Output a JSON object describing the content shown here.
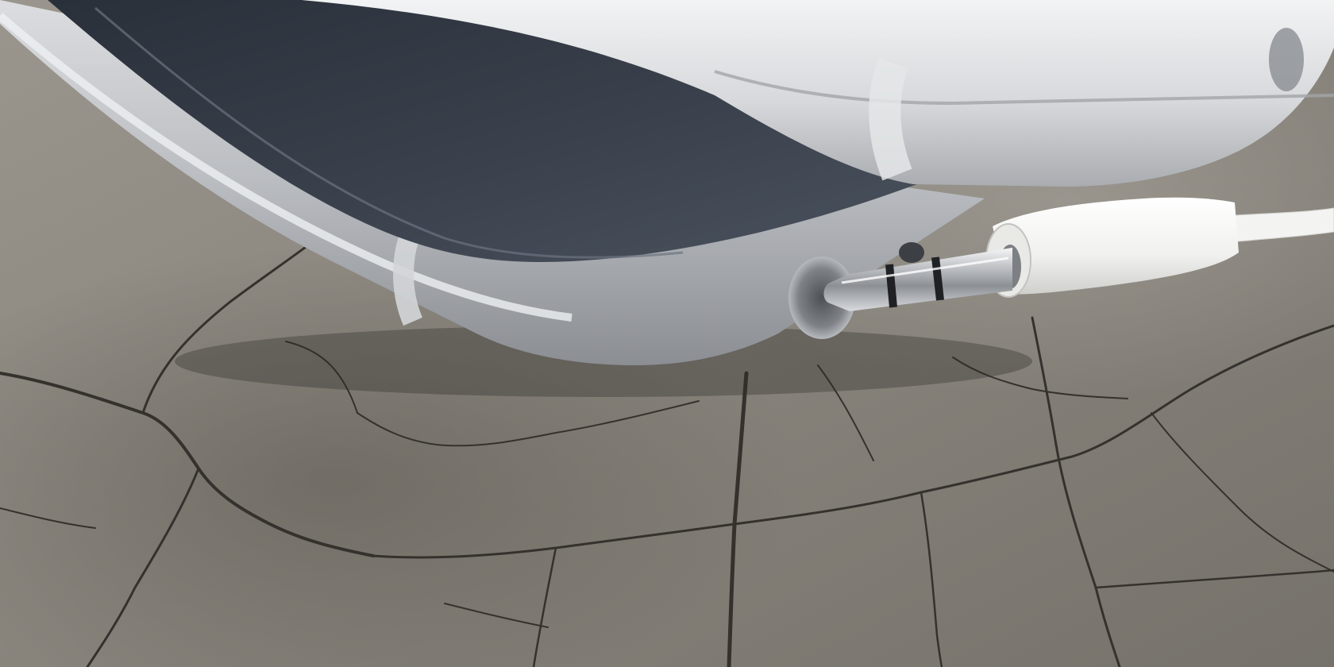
{
  "scene": {
    "subject": "headphone-jack-photo",
    "colors": {
      "wood_base": "#8d8a83",
      "wood_dark": "#3c3934",
      "phone_silver": "#c9cbcd",
      "phone_edge_shadow": "#7b7e82",
      "screen_glass": "#2f3640",
      "plug_white": "#f4f4f2",
      "plug_metal": "#c7c9cc",
      "plug_ring": "#1f2124"
    }
  }
}
